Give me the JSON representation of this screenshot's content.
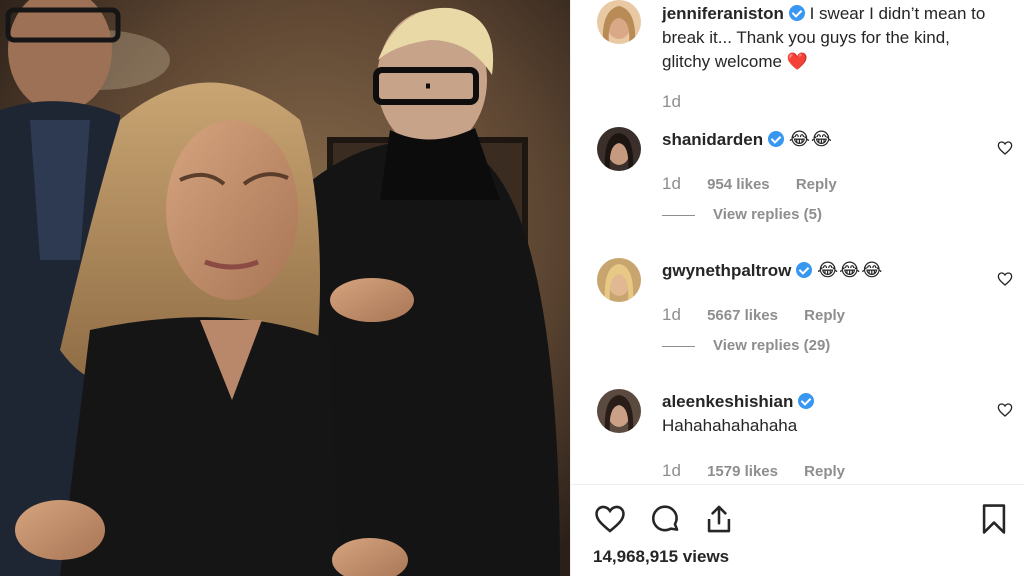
{
  "post": {
    "author": "jenniferaniston",
    "caption": "I swear I didn’t mean to break it... Thank you guys for the kind, glitchy welcome",
    "caption_emoji": "❤️",
    "time": "1d"
  },
  "comments": [
    {
      "username": "shanidarden",
      "text": "😂😂",
      "time": "1d",
      "likes": "954 likes",
      "reply": "Reply",
      "view_replies": "View replies (5)"
    },
    {
      "username": "gwynethpaltrow",
      "text": "😂😂😂",
      "time": "1d",
      "likes": "5667 likes",
      "reply": "Reply",
      "view_replies": "View replies (29)"
    },
    {
      "username": "aleenkeshishian",
      "text": "Hahahahahahaha",
      "time": "1d",
      "likes": "1579 likes",
      "reply": "Reply"
    }
  ],
  "footer": {
    "views": "14,968,915 views"
  },
  "icons": {
    "verified": "verified-badge-icon",
    "like": "heart-icon",
    "comment": "comment-bubble-icon",
    "share": "share-icon",
    "save": "bookmark-icon"
  },
  "colors": {
    "verified_blue": "#3897f0",
    "muted_text": "#8e8e8e",
    "heart_red": "#ed4956"
  }
}
